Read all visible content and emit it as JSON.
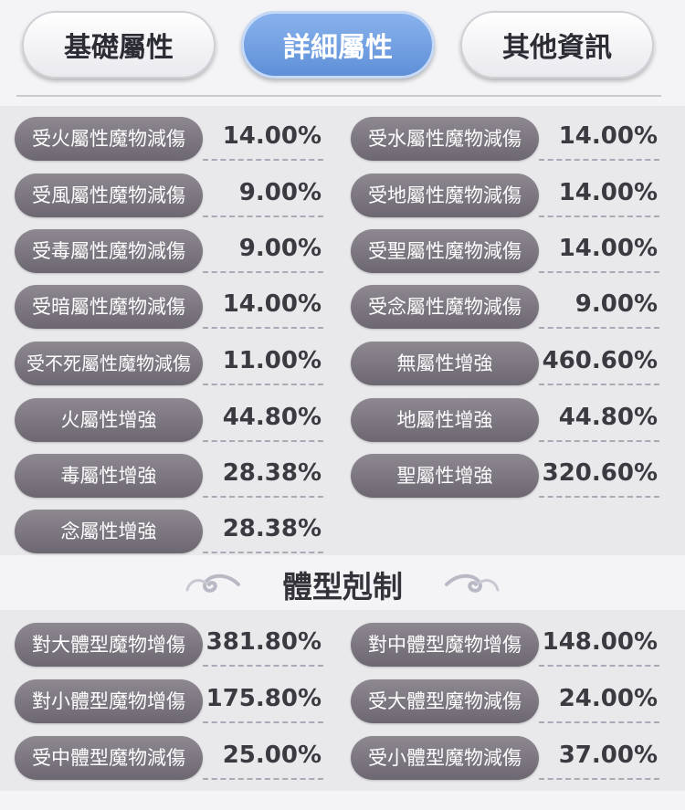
{
  "tabs": [
    {
      "label": "基礎屬性",
      "active": false
    },
    {
      "label": "詳細屬性",
      "active": true
    },
    {
      "label": "其他資訊",
      "active": false
    }
  ],
  "attributes": [
    {
      "label": "受火屬性魔物減傷",
      "value": "14.00%"
    },
    {
      "label": "受水屬性魔物減傷",
      "value": "14.00%"
    },
    {
      "label": "受風屬性魔物減傷",
      "value": "9.00%"
    },
    {
      "label": "受地屬性魔物減傷",
      "value": "14.00%"
    },
    {
      "label": "受毒屬性魔物減傷",
      "value": "9.00%"
    },
    {
      "label": "受聖屬性魔物減傷",
      "value": "14.00%"
    },
    {
      "label": "受暗屬性魔物減傷",
      "value": "14.00%"
    },
    {
      "label": "受念屬性魔物減傷",
      "value": "9.00%"
    },
    {
      "label": "受不死屬性魔物減傷",
      "value": "11.00%"
    },
    {
      "label": "無屬性增強",
      "value": "460.60%"
    },
    {
      "label": "火屬性增強",
      "value": "44.80%"
    },
    {
      "label": "地屬性增強",
      "value": "44.80%"
    },
    {
      "label": "毒屬性增強",
      "value": "28.38%"
    },
    {
      "label": "聖屬性增強",
      "value": "320.60%"
    },
    {
      "label": "念屬性增強",
      "value": "28.38%"
    }
  ],
  "section_title": "體型剋制",
  "size_stats": [
    {
      "label": "對大體型魔物增傷",
      "value": "381.80%"
    },
    {
      "label": "對中體型魔物增傷",
      "value": "148.00%"
    },
    {
      "label": "對小體型魔物增傷",
      "value": "175.80%"
    },
    {
      "label": "受大體型魔物減傷",
      "value": "24.00%"
    },
    {
      "label": "受中體型魔物減傷",
      "value": "25.00%"
    },
    {
      "label": "受小體型魔物減傷",
      "value": "37.00%"
    }
  ],
  "colors": {
    "pill": "#7c7780",
    "active_tab": "#6f9fe2",
    "value_text": "#3a3a40"
  }
}
